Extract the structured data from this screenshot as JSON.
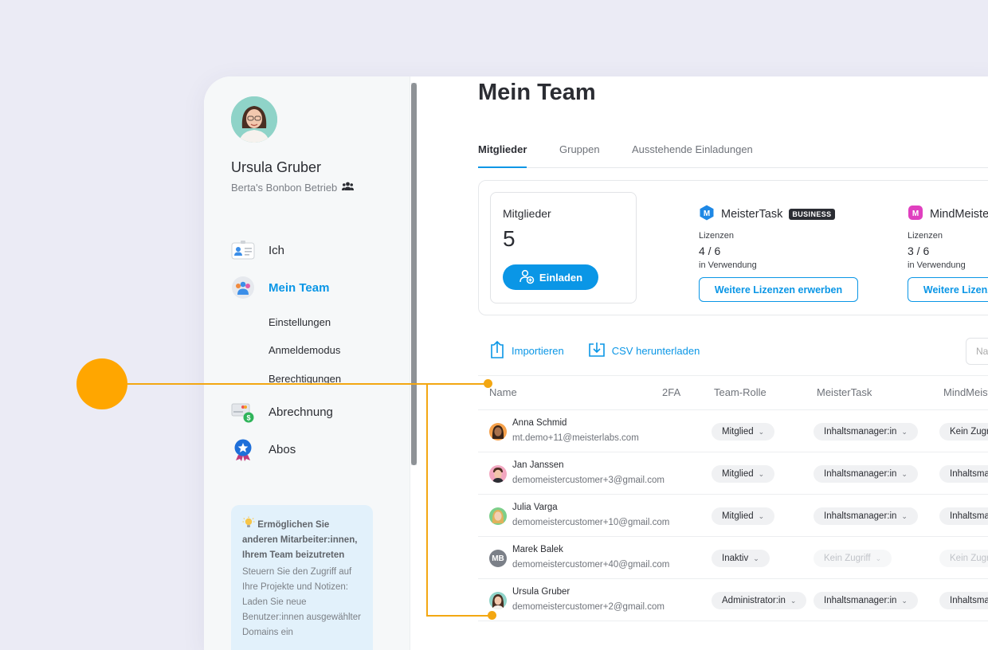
{
  "profile": {
    "name": "Ursula Gruber",
    "org": "Berta's Bonbon Betrieb"
  },
  "nav": {
    "ich": "Ich",
    "mein_team": "Mein Team",
    "sub": [
      "Einstellungen",
      "Anmeldemodus",
      "Berechtigungen"
    ],
    "abrechnung": "Abrechnung",
    "abos": "Abos"
  },
  "hint": {
    "title": "Ermöglichen Sie anderen Mitarbeiter:innen, Ihrem Team beizutreten",
    "body": "Steuern Sie den Zugriff auf Ihre Projekte und Notizen: Laden Sie neue Benutzer:innen ausgewählter Domains ein"
  },
  "page": {
    "title": "Mein Team"
  },
  "tabs": [
    "Mitglieder",
    "Gruppen",
    "Ausstehende Einladungen"
  ],
  "summary": {
    "members_label": "Mitglieder",
    "members_count": "5",
    "invite_label": "Einladen",
    "products": [
      {
        "name": "MeisterTask",
        "badge": "BUSINESS",
        "lic_label": "Lizenzen",
        "count": "4 / 6",
        "in_use": "in Verwendung",
        "button": "Weitere Lizenzen erwerben",
        "color": "#1e88e5"
      },
      {
        "name": "MindMeister",
        "badge": "",
        "lic_label": "Lizenzen",
        "count": "3 / 6",
        "in_use": "in Verwendung",
        "button": "Weitere Lizenzen erwerben",
        "color": "#e03fbf"
      }
    ]
  },
  "actions": {
    "import": "Importieren",
    "csv": "CSV herunterladen"
  },
  "search": {
    "placeholder": "Na"
  },
  "table": {
    "headers": [
      "Name",
      "2FA",
      "Team-Rolle",
      "MeisterTask",
      "MindMeister"
    ],
    "rows": [
      {
        "name": "Anna Schmid",
        "email": "mt.demo+11@meisterlabs.com",
        "role": "Mitglied",
        "mt": "Inhaltsmanager:in",
        "mm": "Kein Zugriff",
        "avatar": "photo-a"
      },
      {
        "name": "Jan Janssen",
        "email": "demomeistercustomer+3@gmail.com",
        "role": "Mitglied",
        "mt": "Inhaltsmanager:in",
        "mm": "Inhaltsmanager:in",
        "avatar": "photo-b"
      },
      {
        "name": "Julia Varga",
        "email": "demomeistercustomer+10@gmail.com",
        "role": "Mitglied",
        "mt": "Inhaltsmanager:in",
        "mm": "Inhaltsmanager:in",
        "avatar": "photo-c"
      },
      {
        "name": "Marek Balek",
        "email": "demomeistercustomer+40@gmail.com",
        "role": "Inaktiv",
        "mt": "Kein Zugriff",
        "mm": "Kein Zugriff",
        "avatar": "MB"
      },
      {
        "name": "Ursula Gruber",
        "email": "demomeistercustomer+2@gmail.com",
        "role": "Administrator:in",
        "mt": "Inhaltsmanager:in",
        "mm": "Inhaltsmanager:in",
        "avatar": "photo-d"
      }
    ]
  },
  "colors": {
    "accent": "#0a96e6",
    "annotation": "#ffa600"
  }
}
